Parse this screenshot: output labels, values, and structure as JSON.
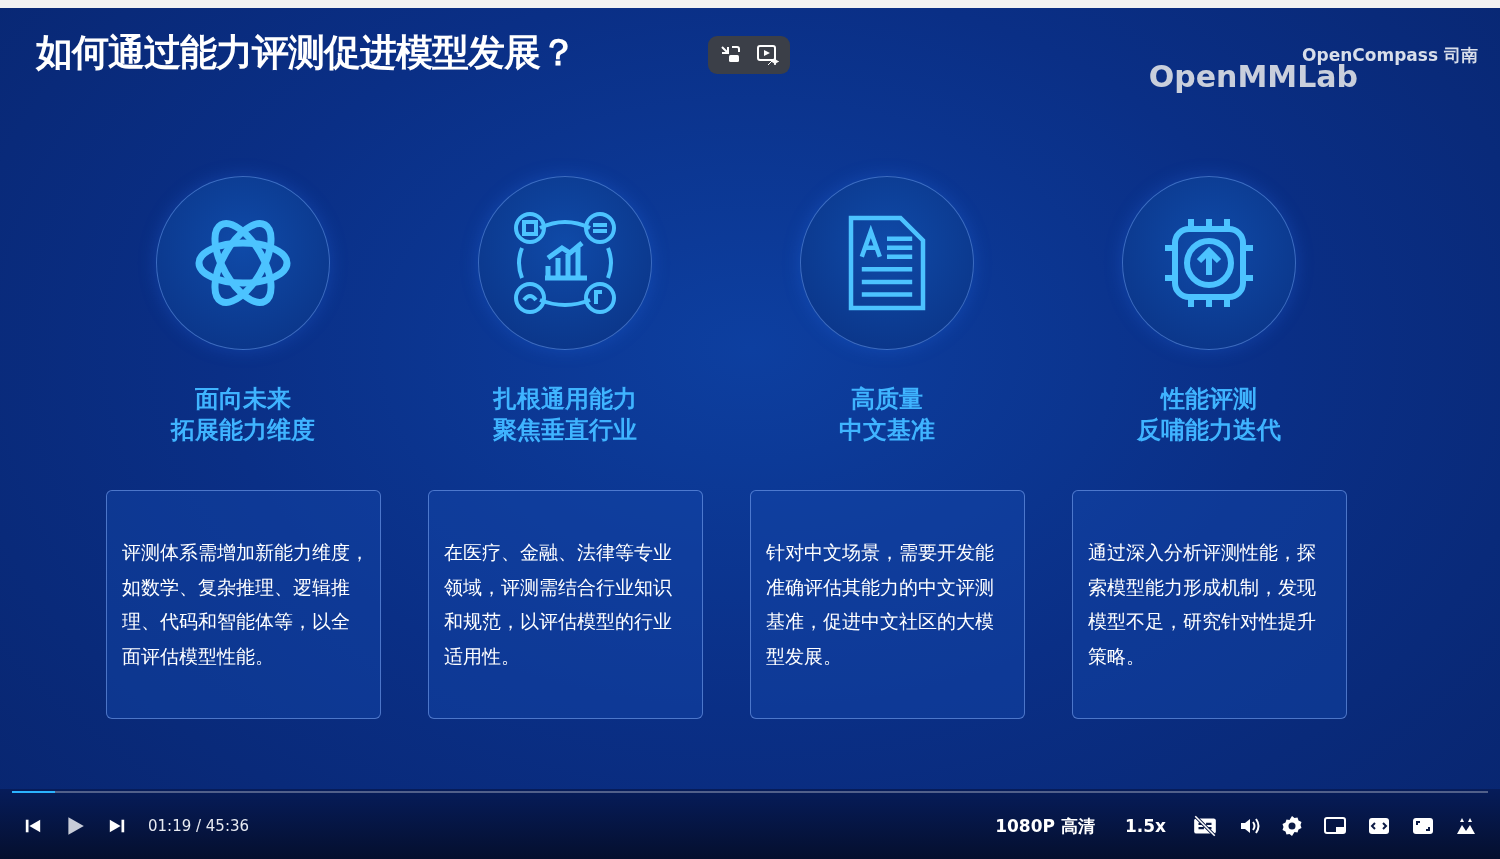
{
  "slide": {
    "title": "如何通过能力评测促进模型发展？",
    "logos": [
      "OpenCompass 司南",
      "OpenMMLab"
    ],
    "columns": [
      {
        "heading": [
          "面向未来",
          "拓展能力维度"
        ],
        "lines": [
          "评测体系需增加新能力维度，",
          "如数学、复杂推理、逻辑推",
          "理、代码和智能体等，以全",
          "面评估模型性能。"
        ]
      },
      {
        "heading": [
          "扎根通用能力",
          "聚焦垂直行业"
        ],
        "lines": [
          "在医疗、金融、法律等专业",
          "领域，评测需结合行业知识",
          "和规范，以评估模型的行业",
          "适用性。"
        ]
      },
      {
        "heading": [
          "高质量",
          "中文基准"
        ],
        "lines": [
          "针对中文场景，需要开发能",
          "准确评估其能力的中文评测",
          "基准，促进中文社区的大模",
          "型发展。"
        ]
      },
      {
        "heading": [
          "性能评测",
          "反哺能力迭代"
        ],
        "lines": [
          "通过深入分析评测性能，探",
          "索模型能力形成机制，发现",
          "模型不足，研究针对性提升",
          "策略。"
        ]
      }
    ]
  },
  "player": {
    "progress": {
      "level": 0.029
    },
    "time": "01:19 / 45:36",
    "quality": "1080P 高清",
    "speed": "1.5x"
  }
}
